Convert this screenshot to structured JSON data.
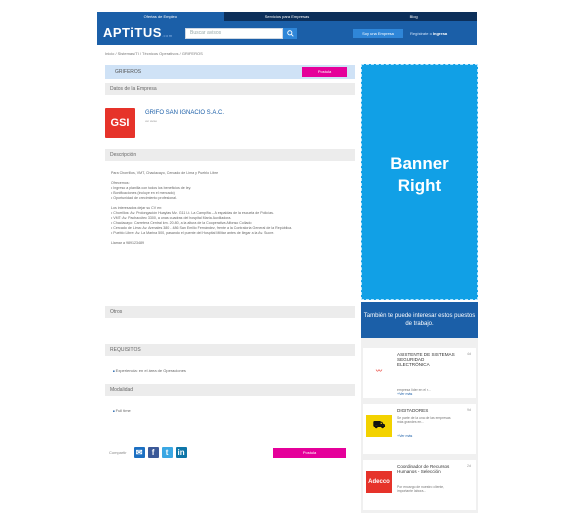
{
  "nav": {
    "tabs": [
      "Ofertas de Empleo",
      "Servicios para Empresas",
      "Blog"
    ]
  },
  "header": {
    "logo": "APTiTUS",
    "logo_suffix": ".com",
    "search_placeholder": "Buscar avisos",
    "empresa_button": "Soy una Empresa",
    "registro_text": "Regístrate o",
    "ingresa_text": "Ingresa"
  },
  "breadcrumb": "Inicio / Sistemas/TI / Técnicos Operativos / GRIFEROS",
  "job": {
    "title": "GRIFEROS",
    "postula_label": "Postula",
    "datos_section": "Datos de la Empresa",
    "company_logo_text": "GSI",
    "company_name": "GRIFO SAN IGNACIO S.A.C.",
    "company_meta": "ver aviso",
    "descripcion_section": "Descripción",
    "description_lines": [
      "Para Chorrillos, VMT, Chaclacayo, Cercado de Lima y Pueblo Libre",
      "",
      "Ofrecemos:",
      "• Ingreso a planilla con todos los beneficios de ley.",
      "• Bonificaciones (incluye en el mercado)",
      "• Oportunidad de crecimiento profesional.",
      "",
      "Los interesados dejar su CV en:",
      "• Chorrillos: Av. Prolongación Huaylas Mz. G11 Lt. La Campiña – A espaldas de la escuela de Policías.",
      "• VMT: Av. Pachacútec 3300, a unas cuadras del hospital María Auxiliadora.",
      "• Chaclacayo: Carretera Central km. 20.80, a la altura de la Cooperativa Alfonso Collado",
      "• Cercado de Lima: Av. Arenales 380 - 486 San Emilio Fernández, frente a la Contraloría General de la República.",
      "• Pueblo Libre: Av. La Marina 500, pasando el puente del Hospital Militar antes de llegar a la Av. Sucre.",
      "",
      "Llamar a 989123489"
    ],
    "otros_section": "Otros",
    "requisitos_section": "REQUISITOS",
    "requisito_item": "Experiencia: en el área de Operaciones",
    "modalidad_section": "Modalidad",
    "modalidad_item": "Full time",
    "compartir_label": "Compartir",
    "postula_bottom_label": "Postula"
  },
  "banner": {
    "line1": "Banner",
    "line2": "Right"
  },
  "related": {
    "heading": "También te puede interesar estos puestos de trabajo.",
    "jobs": [
      {
        "title": "ASISTENTE DE SISTEMAS SEGURIDAD ELECTRÓNICA",
        "desc": "empresa líder en el r...",
        "more": "+Ver más",
        "time": "4d",
        "logo": "",
        "logo_color": "#e6332a"
      },
      {
        "title": "DIGITADORES",
        "desc": "Se parte de la una de las empresas más grandes en...",
        "more": "+Ver más",
        "time": "9d",
        "logo": "",
        "logo_color": "#f3d200"
      },
      {
        "title": "Coordinador de Recursos Humanos - Selección",
        "desc": "Por encargo de nuestro cliente, importante labora...",
        "more": "",
        "time": "2d",
        "logo": "Adecco",
        "logo_color": "#e6332a"
      }
    ]
  },
  "colors": {
    "brand_blue": "#1b5fa8",
    "dark_navy": "#0c2f5a",
    "magenta": "#e5009a",
    "banner_cyan": "#11a0e6"
  }
}
